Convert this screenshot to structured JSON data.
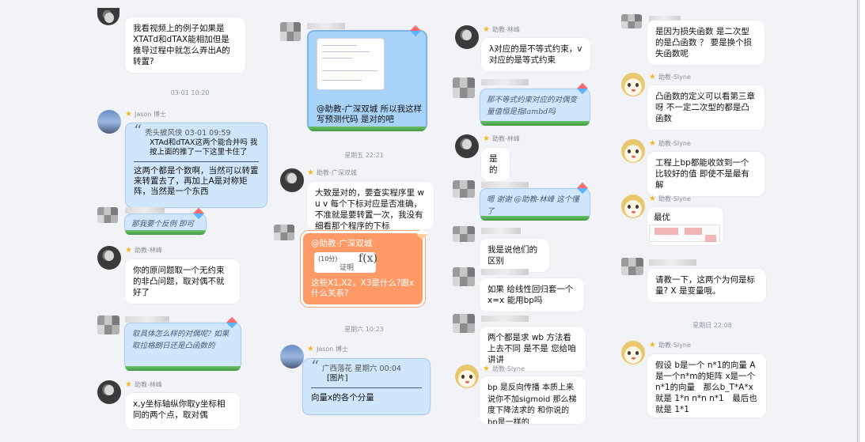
{
  "col1": {
    "msg0_text": "我看视频上的例子如果是XTATd和dTAX能相加但是推导过程中就怎么弄出A的转置?",
    "time1": "03-01 10:20",
    "msg1_name": "Jason 博士",
    "msg1_quote_author": "秃头披风侠 03-01 09:59",
    "msg1_quote": "XTAd和dTAX这两个能合并吗 我按上面的推了一下这里卡住了",
    "msg1_reply": "这两个都是个数啊，当然可以转置来转置去了，再加上A是对称矩阵，当然是一个东西",
    "msg2_text": "那我要个反例 即可",
    "msg3_name": "助教-林峰",
    "msg3_text": "你的原问题取一个无约束的非凸问题，取对偶不就好了",
    "msg4_text": "取具体怎么样的对偶呢? 如果取拉格朗日还是凸函数的",
    "msg5_name": "助教-林峰",
    "msg5_text": "x,y坐标轴纵你取y坐标相同的两个点，取对偶"
  },
  "col2": {
    "msg1_text": "@助教-广深双城 所以我这样写预测代码 是对的吧",
    "time1": "星期五 22:21",
    "msg2_name": "助教-广深双城",
    "msg2_text": "大致是对的，要查实程序里 w u v 每个下标对应是否准确，不准就是要转置一次，我没有细看那个程序的下标",
    "msg3_mention": "@助教-广深双城",
    "msg3_tag": "(10分)",
    "msg3_prove": "证明",
    "msg3_fx": "f(x)",
    "msg3_text": "这些X1,X2，X3是什么?跟x什么关系?",
    "time2": "星期六 10:23",
    "msg4_name": "Jason 博士",
    "msg4_quote_author": "广西落花 星期六 00:04",
    "msg4_quote": "[图片]",
    "msg4_reply": "向量x的各个分量"
  },
  "col3": {
    "msg1_name": "助教-林峰",
    "msg1_text": "λ对应的是不等式约束，v对应的是等式约束",
    "msg2_text": "那不等式约束对应的对偶变量值恒是指lambd吗",
    "msg3_name": "助教-林峰",
    "msg3_text": "是的",
    "msg4_text": "嗯 谢谢 @助教-林峰 这个懂了",
    "msg5_text": "我是说他们的区别",
    "msg6_text": "如果 给线性回归套一个 x=x 能用bp吗",
    "msg7_text": "两个都是求 wb 方法看上去不同 是不是 您给咱讲讲",
    "msg8_name": "助教-Slyne",
    "msg8_text": "bp 是反向传播 本质上来说你不加sigmoid 那么梯度下降法求的 和你说的bp是一样的"
  },
  "col4": {
    "msg1_text": "是因为损失函数 是二次型的是凸函数 ？ 要是换个损失函数呢",
    "msg2_name": "助教-Slyne",
    "msg2_text": "凸函数的定义可以看第三章呀 不一定二次型的都是凸函数",
    "msg3_name": "助教-Slyne",
    "msg3_text": "工程上bp都能收敛到一个比较好的值 即使不是最有解",
    "msg4_name": "助教-Slyne",
    "msg4_text": "最优",
    "msg5_text": "请教一下，这两个为何是标量? X 是变量哦。",
    "time1": "星期日 22:08",
    "msg6_name": "助教-Slyne",
    "msg6_text": "假设 b是一个 n*1的向量 A是一个n*m的矩阵 x是一个n*1的向量　那么b_T*A*x 就是 1*n n*n n*1　最后也就是 1*1"
  },
  "icons": [
    "star-icon",
    "kite-icon",
    "quote-icon"
  ],
  "colors": {
    "background": "#f2f3f7",
    "bubble": "#ffffff",
    "bubble_blue": "#cfe6fb",
    "bubble_orange": "#ff9a66",
    "star": "#f3b826"
  }
}
